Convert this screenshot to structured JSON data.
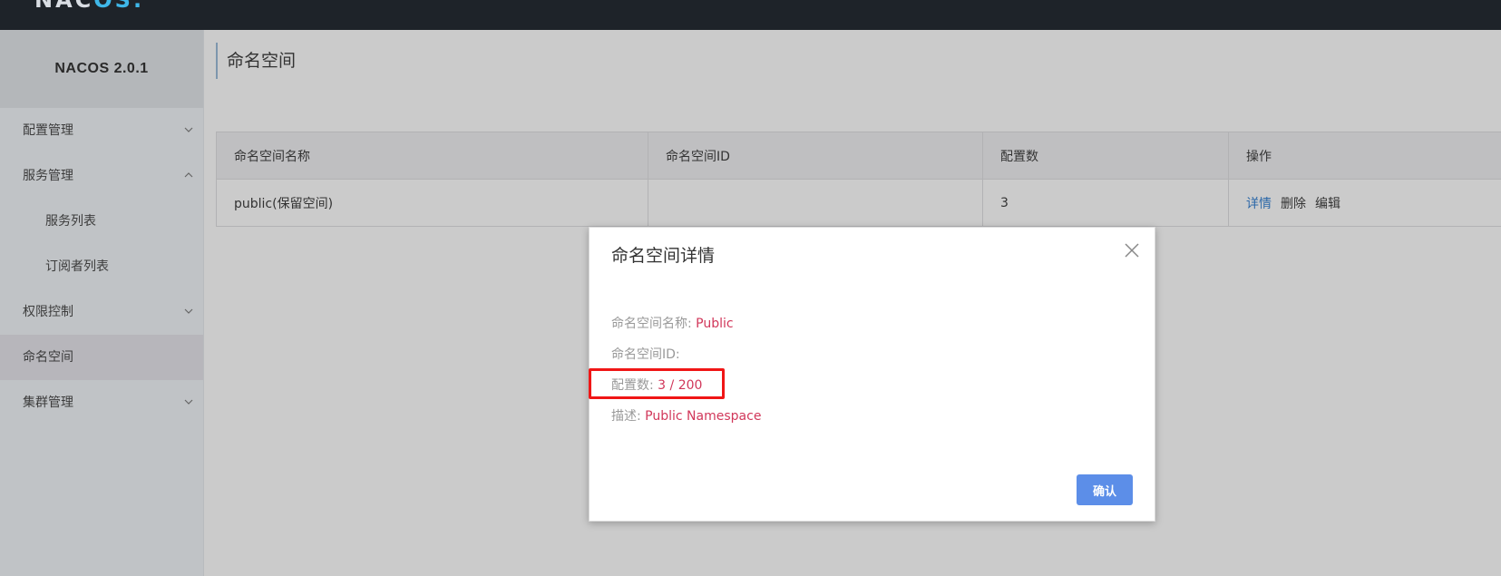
{
  "topbar": {
    "logo_main": "NAC",
    "logo_accent": "OS."
  },
  "sidebar": {
    "brand": "NACOS 2.0.1",
    "items": [
      {
        "label": "配置管理",
        "chevron": "down"
      },
      {
        "label": "服务管理",
        "chevron": "up"
      },
      {
        "label": "服务列表"
      },
      {
        "label": "订阅者列表"
      },
      {
        "label": "权限控制",
        "chevron": "down"
      },
      {
        "label": "命名空间",
        "active": true
      },
      {
        "label": "集群管理",
        "chevron": "down"
      }
    ]
  },
  "page": {
    "title": "命名空间"
  },
  "table": {
    "headers": [
      "命名空间名称",
      "命名空间ID",
      "配置数",
      "操作"
    ],
    "rows": [
      {
        "name": "public(保留空间)",
        "id": "",
        "count": "3",
        "ops": [
          "详情",
          "删除",
          "编辑"
        ]
      }
    ]
  },
  "dialog": {
    "title": "命名空间详情",
    "fields": {
      "name_label": "命名空间名称:",
      "name_value": "Public",
      "id_label": "命名空间ID:",
      "id_value": "",
      "count_label": "配置数:",
      "count_value": "3 / 200",
      "desc_label": "描述:",
      "desc_value": "Public Namespace"
    },
    "confirm_label": "确认"
  },
  "colors": {
    "topbar": "#1e2329",
    "sidebar": "#c0c3c6",
    "link": "#2c68a8",
    "value_red": "#d1375a",
    "highlight": "#f01616",
    "primary_button": "#5c8ee8"
  }
}
